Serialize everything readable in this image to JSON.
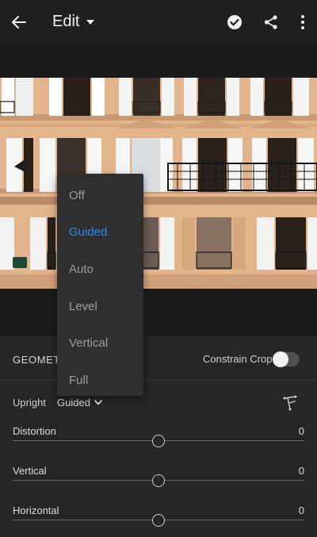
{
  "appbar": {
    "title": "Edit",
    "icons": {
      "back": "arrow-left-icon",
      "caret": "caret-down-icon",
      "done": "check-circle-icon",
      "share": "share-icon",
      "more": "more-vert-icon"
    }
  },
  "photo": {
    "icon": "photo-building-facade"
  },
  "panel": {
    "section_title": "GEOMETRY",
    "constrain_crop_label": "Constrain Crop",
    "constrain_crop_on": false,
    "upright_label": "Upright",
    "upright_value": "Guided",
    "crop_tool_icon": "guided-upright-tool-icon",
    "sliders": [
      {
        "label": "Distortion",
        "value": "0",
        "fraction": 0.5
      },
      {
        "label": "Vertical",
        "value": "0",
        "fraction": 0.5
      },
      {
        "label": "Horizontal",
        "value": "0",
        "fraction": 0.5
      }
    ]
  },
  "menu": {
    "items": [
      "Off",
      "Guided",
      "Auto",
      "Level",
      "Vertical",
      "Full"
    ],
    "selected": "Guided",
    "selected_color": "#2a8bf2"
  }
}
